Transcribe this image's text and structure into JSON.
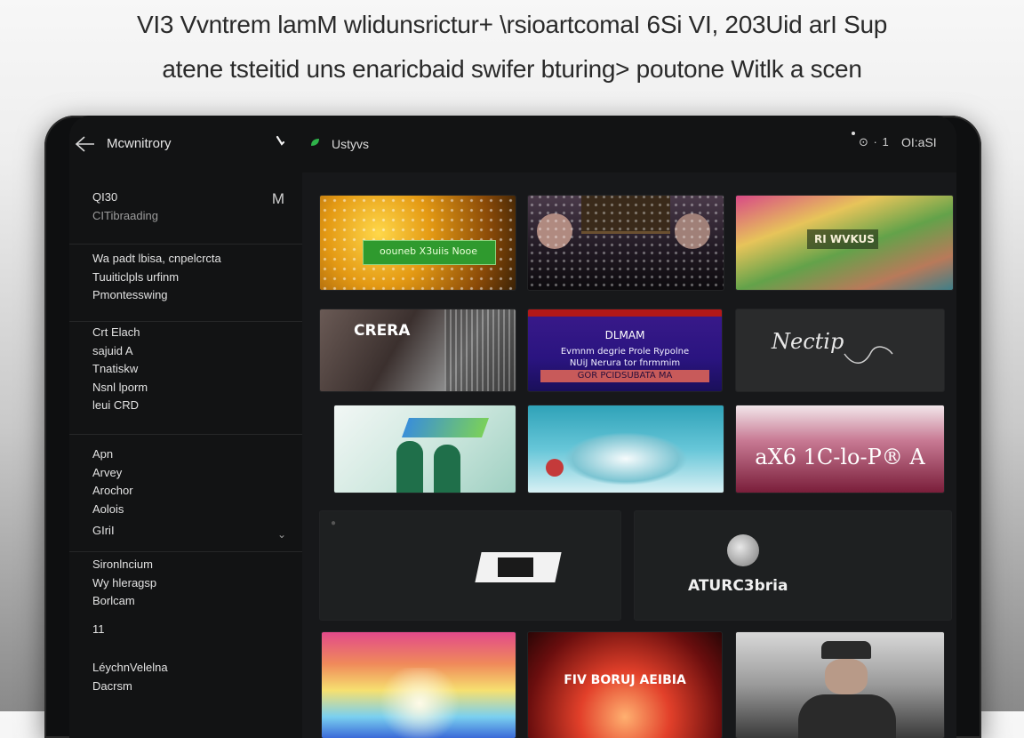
{
  "headline": {
    "line1": "VI3 Vvntrem lamM wlidunsrictur+ \\rsioartcomaI 6Si VI, 203Uid arI Sup",
    "line2": "atene tsteitid uns enaricbaid swifer bturing> poutone Witlk a scen"
  },
  "topbar": {
    "title": "Mcwnitrory",
    "tab_label": "Ustyvs",
    "status_icons": "⊙ · 1",
    "status_text": "OI:aSI",
    "icons": [
      "back-arrow-icon",
      "tick-icon",
      "leaf-icon"
    ]
  },
  "sidebar": {
    "groups": [
      {
        "lines": [
          "QI30",
          "CITibraading"
        ],
        "badge": "M"
      },
      {
        "lines": [
          "Wa padt lbisa, cnpelcrcta",
          "Tuuiticlpls urfinm",
          "Pmontesswing"
        ]
      },
      {
        "lines": [
          "Crt Elach",
          "sajuid A",
          "Tnatiskw",
          "Nsnl lporm",
          "leui CRD"
        ]
      },
      {
        "lines": [
          "Apn",
          "Arvey",
          "Arochor",
          "Aolois"
        ]
      },
      {
        "lines": [
          "GIriI"
        ],
        "chevron": "⌄"
      },
      {
        "lines": [
          "Sironlncium",
          "Wy hleragsp",
          "Borlcam"
        ]
      },
      {
        "lines": [
          "11"
        ]
      },
      {
        "lines": [
          "LéychnVelelna",
          "Dacrsm"
        ]
      }
    ]
  },
  "tiles": [
    {
      "name": "tile-golden-sparkle",
      "caption": "oouneb X3uiis Nooe"
    },
    {
      "name": "tile-cabinet-hands",
      "caption": ""
    },
    {
      "name": "tile-floral-garden",
      "caption": "RI WVKUS"
    },
    {
      "name": "tile-crera",
      "caption": "CRERA"
    },
    {
      "name": "tile-dlmam",
      "caption": "DLMAM",
      "sub": [
        "Evmnm degrie Prole Rypolne",
        "NUiJ Nerura tor fnrmmim",
        "GOR PCIDSUBATA MA"
      ]
    },
    {
      "name": "tile-script-logo",
      "caption": "Nectip"
    },
    {
      "name": "tile-sketch-figures",
      "caption": ""
    },
    {
      "name": "tile-teal-wave",
      "caption": ""
    },
    {
      "name": "tile-pink-abstract",
      "caption": "aX6 1C-lo-P® A"
    },
    {
      "name": "tile-wide-device",
      "caption": ""
    },
    {
      "name": "tile-wide-emblem",
      "caption": "ATURC3bria"
    },
    {
      "name": "tile-rainbow-gradient",
      "caption": ""
    },
    {
      "name": "tile-red-flare",
      "caption": "FIV BORUJ AEIBIA"
    },
    {
      "name": "tile-helmet-figure",
      "caption": ""
    }
  ],
  "colors": {
    "accent_green": "#2fb34a",
    "panel": "#121314",
    "content_bg": "#17181a"
  }
}
